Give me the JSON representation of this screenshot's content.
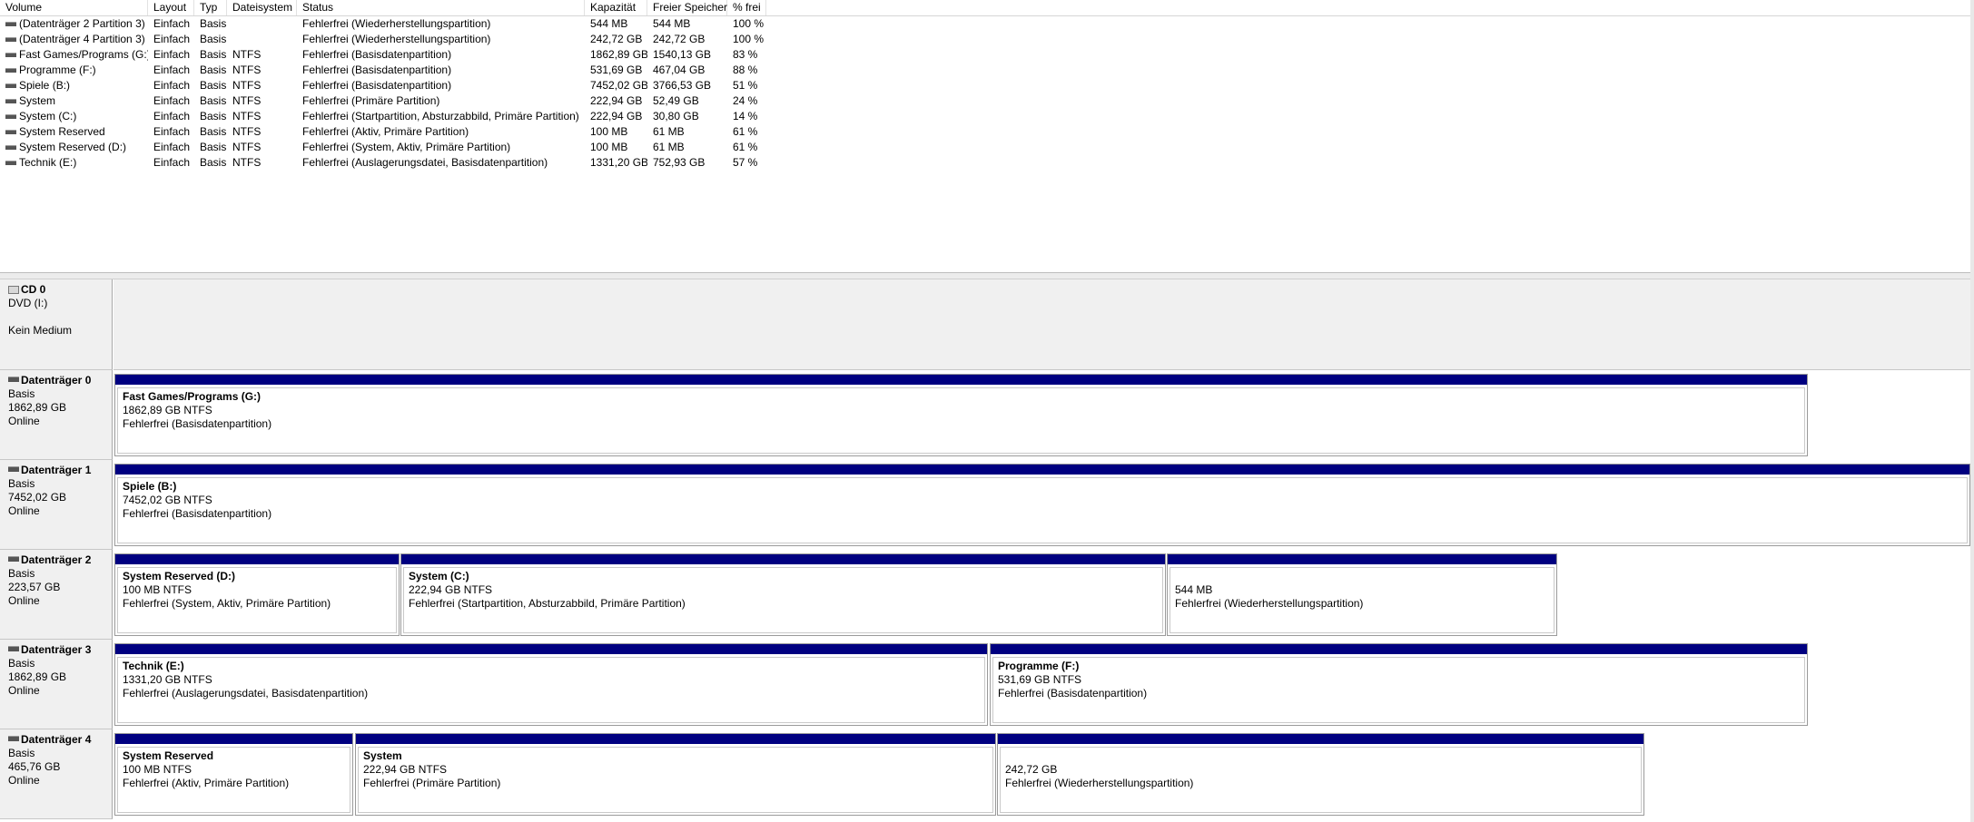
{
  "columns": [
    "Volume",
    "Layout",
    "Typ",
    "Dateisystem",
    "Status",
    "Kapazität",
    "Freier Speicher",
    "% frei"
  ],
  "volumes": [
    {
      "name": "(Datenträger 2 Partition 3)",
      "layout": "Einfach",
      "type": "Basis",
      "fs": "",
      "status": "Fehlerfrei (Wiederherstellungspartition)",
      "capacity": "544 MB",
      "free": "544 MB",
      "pct": "100 %"
    },
    {
      "name": "(Datenträger 4 Partition 3)",
      "layout": "Einfach",
      "type": "Basis",
      "fs": "",
      "status": "Fehlerfrei (Wiederherstellungspartition)",
      "capacity": "242,72 GB",
      "free": "242,72 GB",
      "pct": "100 %"
    },
    {
      "name": "Fast Games/Programs (G:)",
      "layout": "Einfach",
      "type": "Basis",
      "fs": "NTFS",
      "status": "Fehlerfrei (Basisdatenpartition)",
      "capacity": "1862,89 GB",
      "free": "1540,13 GB",
      "pct": "83 %"
    },
    {
      "name": "Programme (F:)",
      "layout": "Einfach",
      "type": "Basis",
      "fs": "NTFS",
      "status": "Fehlerfrei (Basisdatenpartition)",
      "capacity": "531,69 GB",
      "free": "467,04 GB",
      "pct": "88 %"
    },
    {
      "name": "Spiele (B:)",
      "layout": "Einfach",
      "type": "Basis",
      "fs": "NTFS",
      "status": "Fehlerfrei (Basisdatenpartition)",
      "capacity": "7452,02 GB",
      "free": "3766,53 GB",
      "pct": "51 %"
    },
    {
      "name": "System",
      "layout": "Einfach",
      "type": "Basis",
      "fs": "NTFS",
      "status": "Fehlerfrei (Primäre Partition)",
      "capacity": "222,94 GB",
      "free": "52,49 GB",
      "pct": "24 %"
    },
    {
      "name": "System (C:)",
      "layout": "Einfach",
      "type": "Basis",
      "fs": "NTFS",
      "status": "Fehlerfrei (Startpartition, Absturzabbild, Primäre Partition)",
      "capacity": "222,94 GB",
      "free": "30,80 GB",
      "pct": "14 %"
    },
    {
      "name": "System Reserved",
      "layout": "Einfach",
      "type": "Basis",
      "fs": "NTFS",
      "status": "Fehlerfrei (Aktiv, Primäre Partition)",
      "capacity": "100 MB",
      "free": "61 MB",
      "pct": "61 %"
    },
    {
      "name": "System Reserved (D:)",
      "layout": "Einfach",
      "type": "Basis",
      "fs": "NTFS",
      "status": "Fehlerfrei (System, Aktiv, Primäre Partition)",
      "capacity": "100 MB",
      "free": "61 MB",
      "pct": "61 %"
    },
    {
      "name": "Technik (E:)",
      "layout": "Einfach",
      "type": "Basis",
      "fs": "NTFS",
      "status": "Fehlerfrei (Auslagerungsdatei, Basisdatenpartition)",
      "capacity": "1331,20 GB",
      "free": "752,93 GB",
      "pct": "57 %"
    }
  ],
  "cd": {
    "name": "CD 0",
    "line1": "DVD (I:)",
    "line2": "Kein Medium"
  },
  "disks": [
    {
      "name": "Datenträger 0",
      "type": "Basis",
      "size": "1862,89 GB",
      "state": "Online",
      "partitions": [
        {
          "name": "Fast Games/Programs  (G:)",
          "size": "1862,89 GB NTFS",
          "status": "Fehlerfrei (Basisdatenpartition)"
        }
      ]
    },
    {
      "name": "Datenträger 1",
      "type": "Basis",
      "size": "7452,02 GB",
      "state": "Online",
      "partitions": [
        {
          "name": "Spiele  (B:)",
          "size": "7452,02 GB NTFS",
          "status": "Fehlerfrei (Basisdatenpartition)"
        }
      ]
    },
    {
      "name": "Datenträger 2",
      "type": "Basis",
      "size": "223,57 GB",
      "state": "Online",
      "partitions": [
        {
          "name": "System Reserved  (D:)",
          "size": "100 MB NTFS",
          "status": "Fehlerfrei (System, Aktiv, Primäre Partition)"
        },
        {
          "name": "System  (C:)",
          "size": "222,94 GB NTFS",
          "status": "Fehlerfrei (Startpartition, Absturzabbild, Primäre Partition)"
        },
        {
          "name": "",
          "size": "544 MB",
          "status": "Fehlerfrei (Wiederherstellungspartition)"
        }
      ]
    },
    {
      "name": "Datenträger 3",
      "type": "Basis",
      "size": "1862,89 GB",
      "state": "Online",
      "partitions": [
        {
          "name": "Technik  (E:)",
          "size": "1331,20 GB NTFS",
          "status": "Fehlerfrei (Auslagerungsdatei, Basisdatenpartition)"
        },
        {
          "name": "Programme  (F:)",
          "size": "531,69 GB NTFS",
          "status": "Fehlerfrei (Basisdatenpartition)"
        }
      ]
    },
    {
      "name": "Datenträger 4",
      "type": "Basis",
      "size": "465,76 GB",
      "state": "Online",
      "partitions": [
        {
          "name": "System Reserved",
          "size": "100 MB NTFS",
          "status": "Fehlerfrei (Aktiv, Primäre Partition)"
        },
        {
          "name": "System",
          "size": "222,94 GB NTFS",
          "status": "Fehlerfrei (Primäre Partition)"
        },
        {
          "name": "",
          "size": "242,72 GB",
          "status": "Fehlerfrei (Wiederherstellungspartition)"
        }
      ]
    }
  ],
  "colors": {
    "partition_bar": "#000080",
    "label_bg": "#f0f0f0"
  }
}
